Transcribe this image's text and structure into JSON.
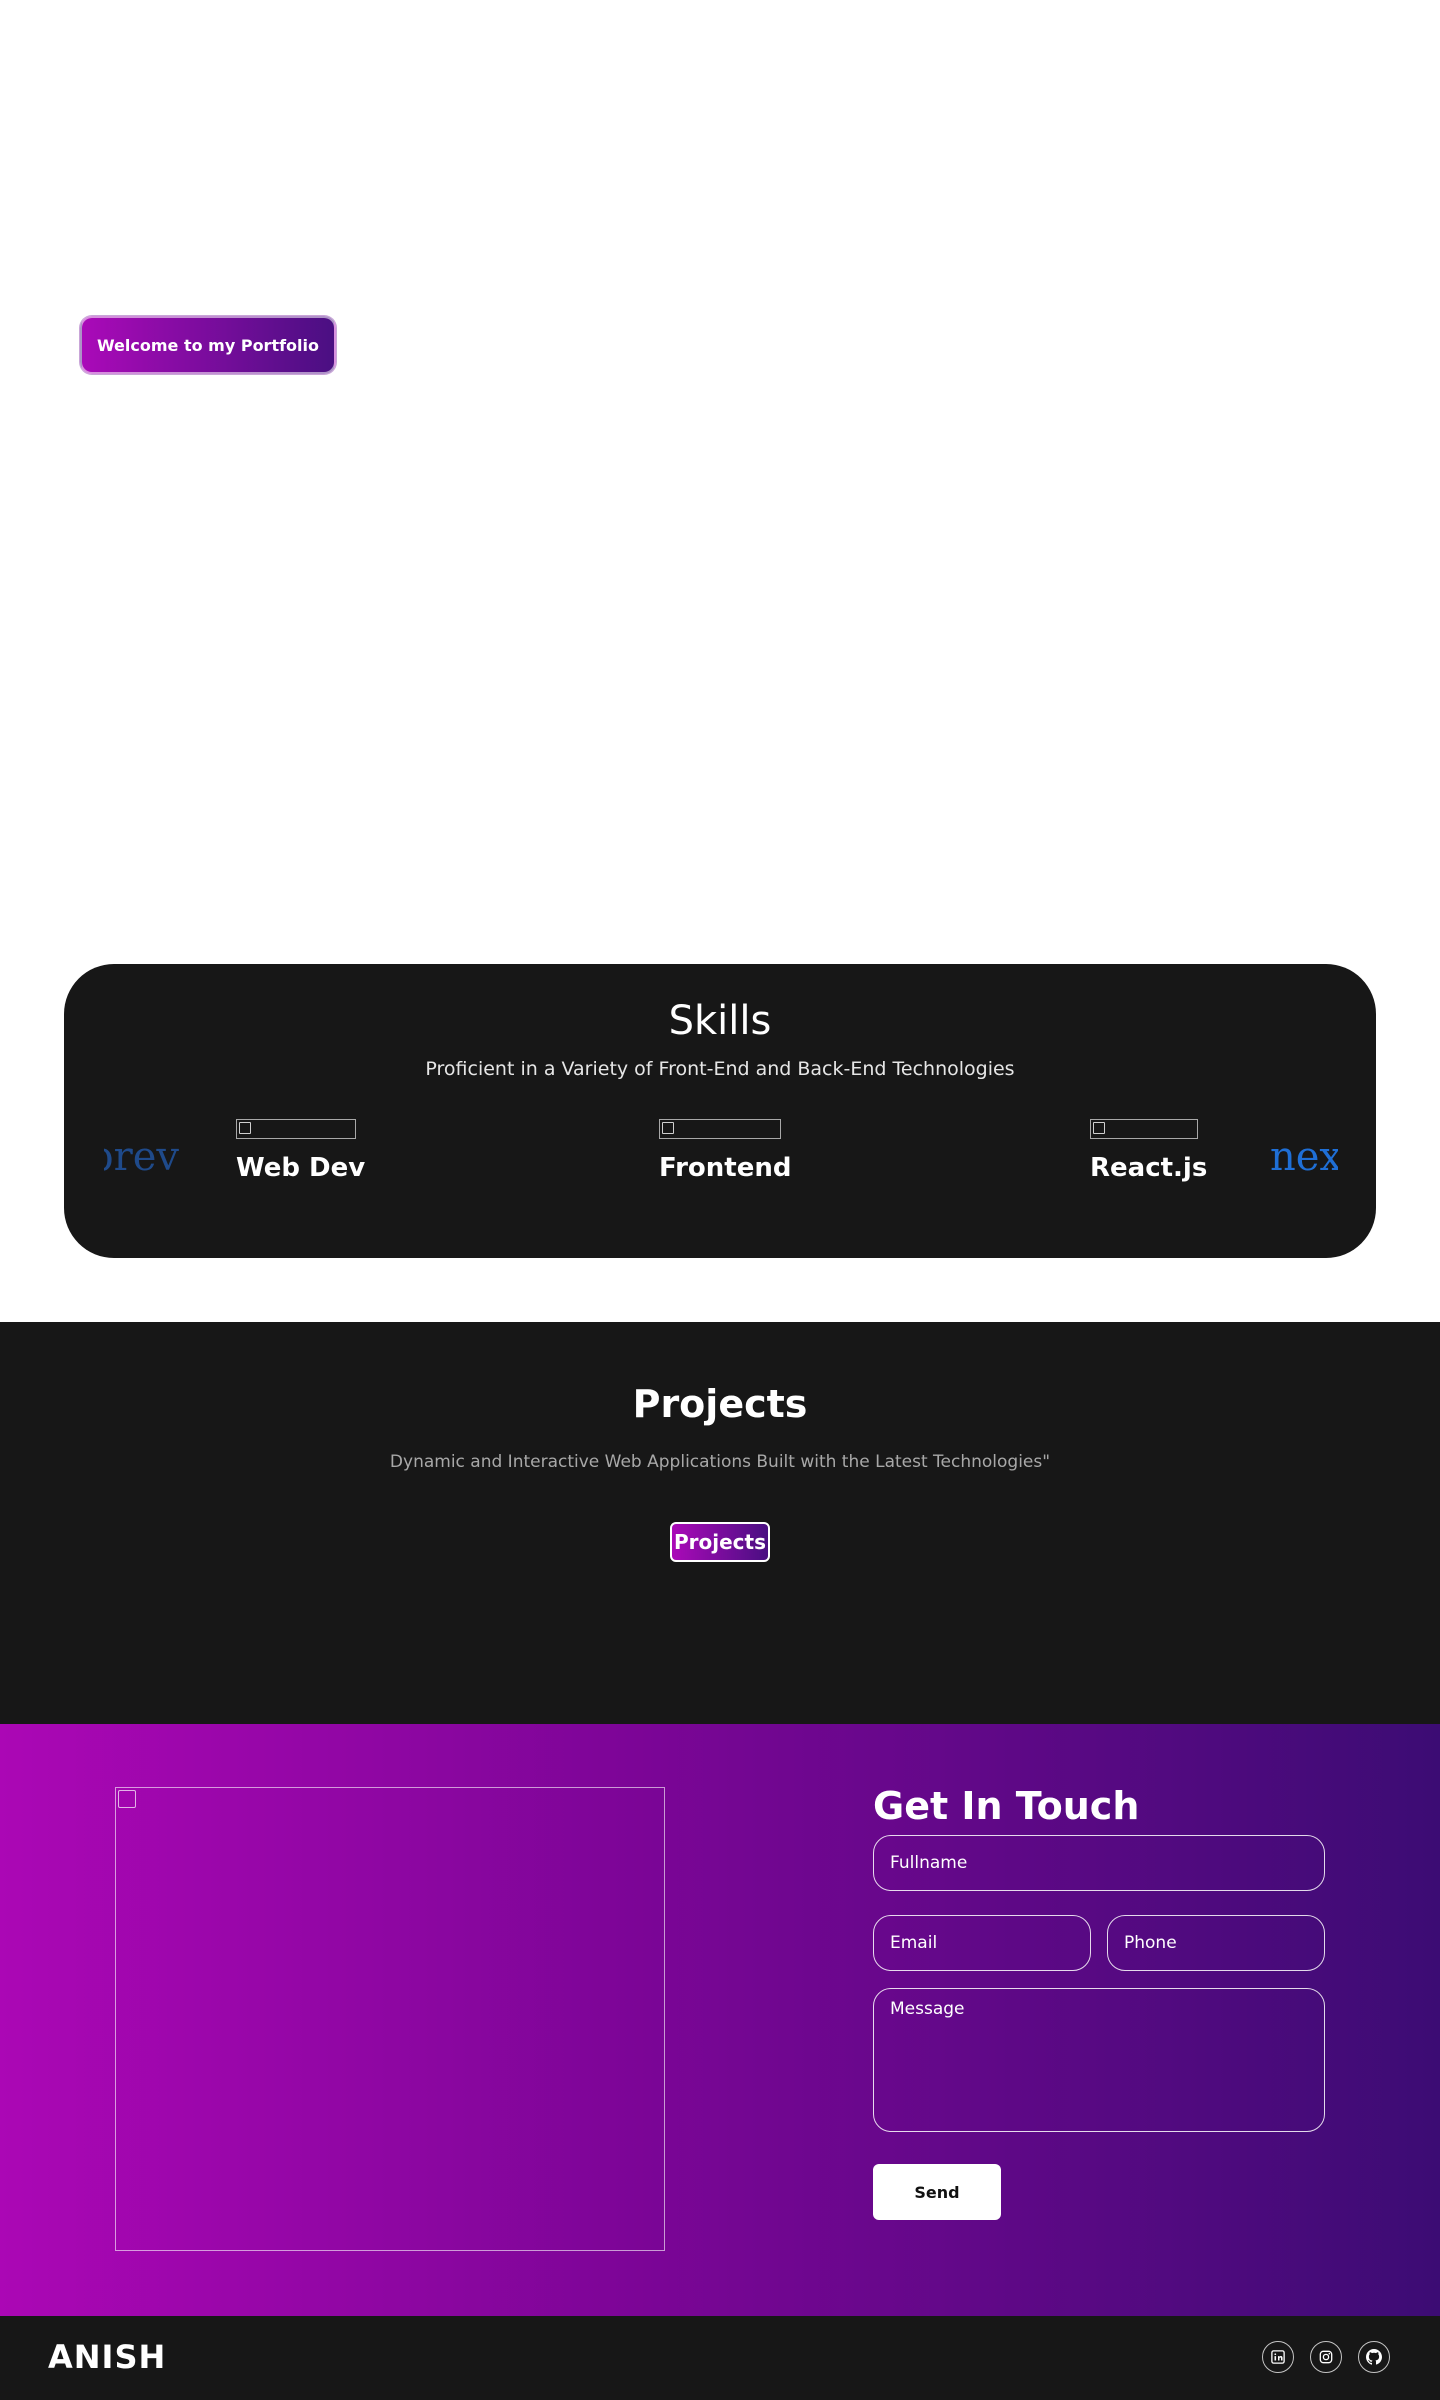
{
  "hero": {
    "badge_label": "Welcome to my Portfolio"
  },
  "skills": {
    "title": "Skills",
    "subtitle": "Proficient in a Variety of Front-End and Back-End Technologies",
    "prev_label": "prev",
    "next_label": "next",
    "items": [
      {
        "label": "Web Dev"
      },
      {
        "label": "Frontend"
      },
      {
        "label": "React.js"
      }
    ]
  },
  "projects": {
    "title": "Projects",
    "subtitle": "Dynamic and Interactive Web Applications Built with the Latest Technologies\"",
    "tab_label": "Projects"
  },
  "contact": {
    "title": "Get In Touch",
    "fullname_placeholder": "Fullname",
    "email_placeholder": "Email",
    "phone_placeholder": "Phone",
    "message_placeholder": "Message",
    "send_label": "Send"
  },
  "footer": {
    "brand": "ANISH",
    "social_icons": [
      "linkedin-icon",
      "instagram-icon",
      "github-icon"
    ]
  },
  "colors": {
    "gradient_start": "#ab07b5",
    "gradient_end": "#3c0c74",
    "dark_bg": "#171717",
    "arrow_blue": "#1f6fd6"
  }
}
